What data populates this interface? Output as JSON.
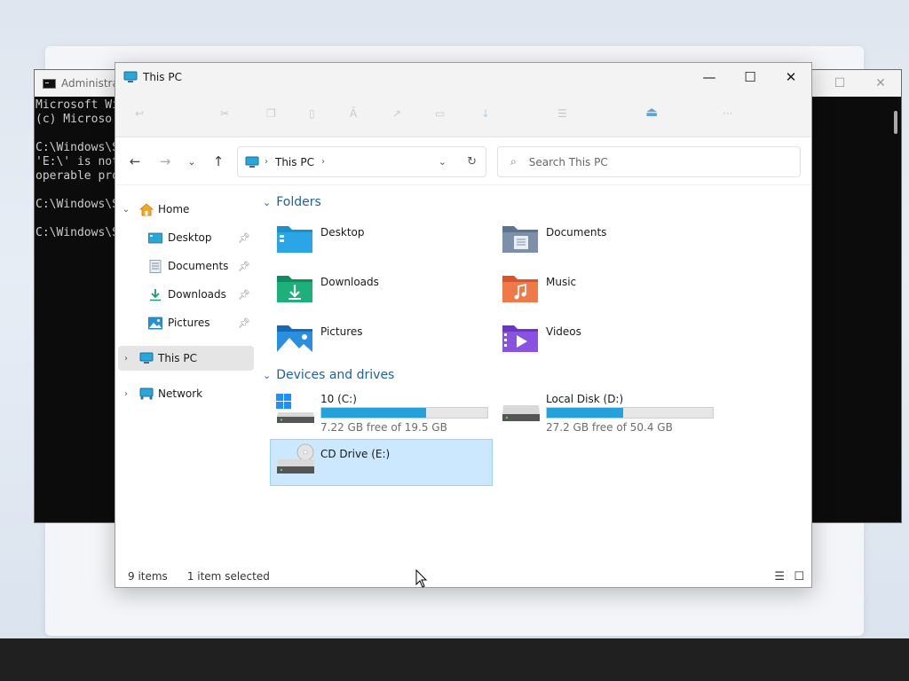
{
  "cmd": {
    "title": "Administrator",
    "lines": [
      "Microsoft Wi",
      "(c) Microso",
      "",
      "C:\\Windows\\S",
      "'E:\\' is not",
      "operable pro",
      "",
      "C:\\Windows\\S",
      "",
      "C:\\Windows\\S"
    ]
  },
  "explorer": {
    "title": "This PC",
    "address": "This PC",
    "search_placeholder": "Search This PC",
    "nav": {
      "home": "Home",
      "desktop": "Desktop",
      "documents": "Documents",
      "downloads": "Downloads",
      "pictures": "Pictures",
      "this_pc": "This PC",
      "network": "Network"
    },
    "folders_header": "Folders",
    "folders": [
      {
        "name": "Desktop",
        "icon": "desktop-folder-icon"
      },
      {
        "name": "Documents",
        "icon": "documents-folder-icon"
      },
      {
        "name": "Downloads",
        "icon": "downloads-folder-icon"
      },
      {
        "name": "Music",
        "icon": "music-folder-icon"
      },
      {
        "name": "Pictures",
        "icon": "pictures-folder-icon"
      },
      {
        "name": "Videos",
        "icon": "videos-folder-icon"
      }
    ],
    "drives_header": "Devices and drives",
    "drives": [
      {
        "name": "10 (C:)",
        "free": "7.22 GB free of 19.5 GB",
        "used_fraction": 0.63
      },
      {
        "name": "Local Disk (D:)",
        "free": "27.2 GB free of 50.4 GB",
        "used_fraction": 0.46
      },
      {
        "name": "CD Drive (E:)",
        "free": "",
        "used_fraction": null
      }
    ],
    "status": {
      "items": "9 items",
      "selected": "1 item selected"
    }
  },
  "colors": {
    "accent": "#26a0da",
    "selection": "#cce8ff",
    "section_header": "#1f5fa8"
  }
}
